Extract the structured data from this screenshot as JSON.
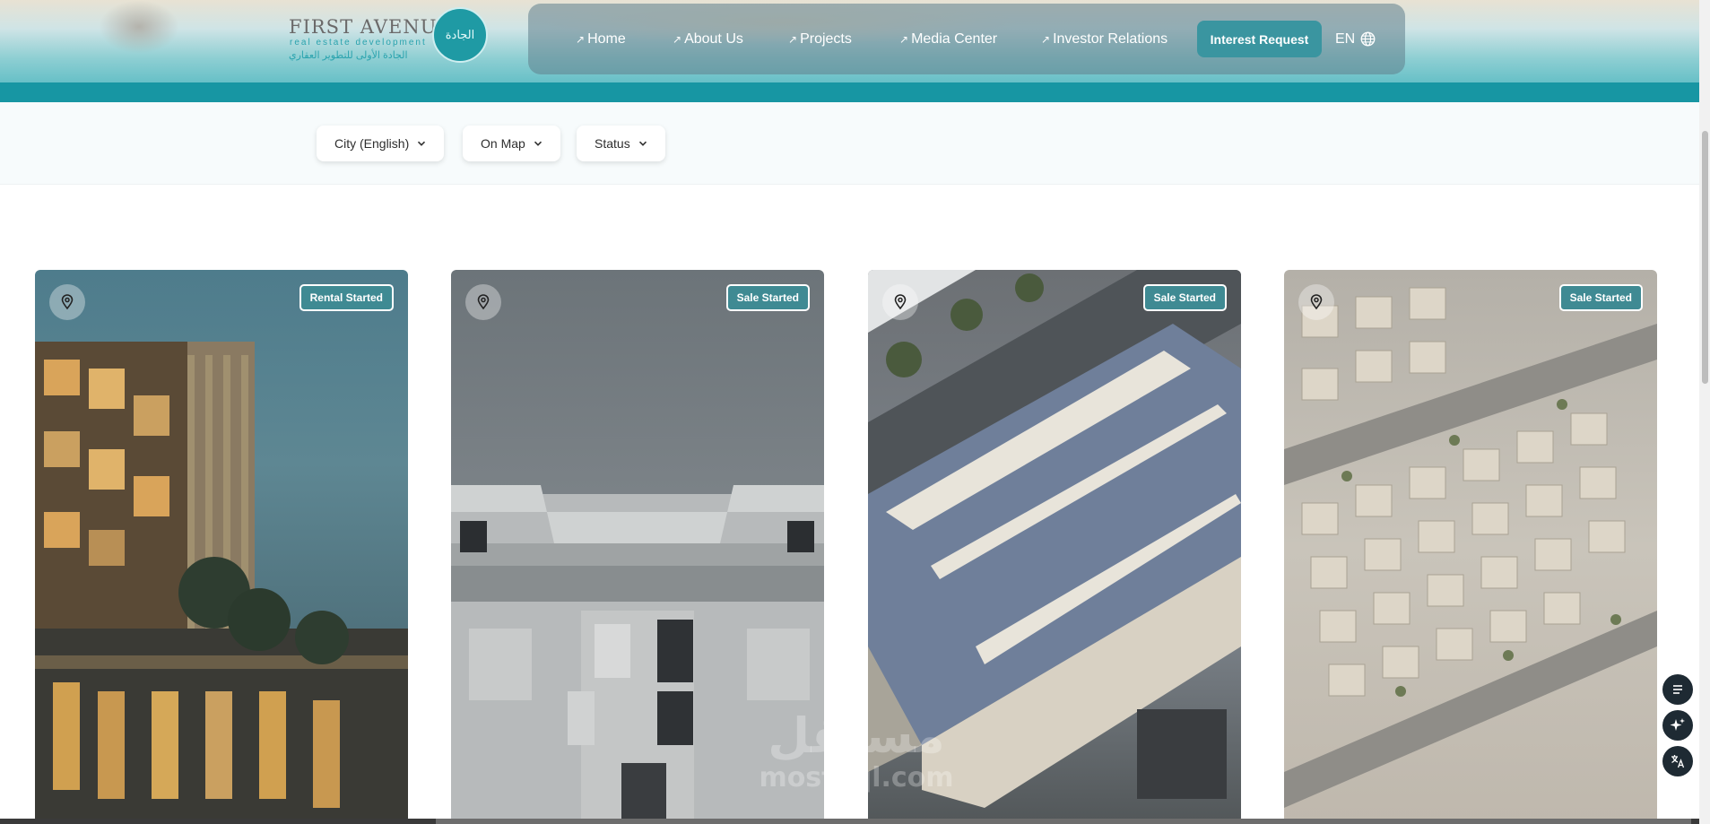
{
  "header": {
    "logo": {
      "title": "FIRST AVENUE",
      "subtitle": "real estate development",
      "arabic": "الجادة الأولى للتطوير العقاري",
      "seal_text": "الجادة"
    },
    "nav": [
      {
        "label": "Home"
      },
      {
        "label": "About Us"
      },
      {
        "label": "Projects"
      },
      {
        "label": "Media Center"
      },
      {
        "label": "Investor Relations"
      }
    ],
    "interest_label": "Interest Request",
    "lang_label": "EN",
    "colors": {
      "teal": "#1796a3",
      "badge": "#3f8a93",
      "button": "#3a95a0"
    }
  },
  "filters": [
    {
      "label": "City (English)"
    },
    {
      "label": "On Map"
    },
    {
      "label": "Status"
    }
  ],
  "cards": [
    {
      "status": "Rental Started",
      "icon": "map-pin-icon"
    },
    {
      "status": "Sale Started",
      "icon": "map-pin-icon"
    },
    {
      "status": "Sale Started",
      "icon": "map-pin-icon"
    },
    {
      "status": "Sale Started",
      "icon": "map-pin-icon"
    }
  ],
  "watermark": {
    "arabic": "مستقل",
    "latin": "mostaql.com"
  },
  "floating_buttons": [
    "list-icon",
    "sparkle-icon",
    "translate-icon"
  ]
}
